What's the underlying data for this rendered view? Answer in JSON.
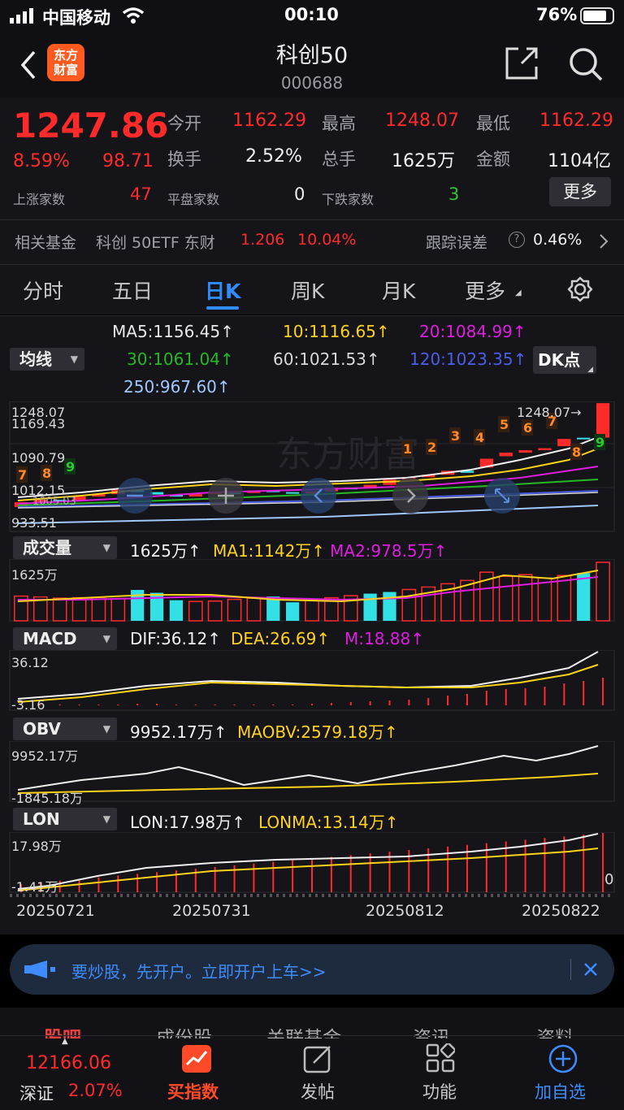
{
  "status_bar": {
    "carrier": "中国移动",
    "time": "00:10",
    "battery": "76%"
  },
  "header": {
    "title": "科创50",
    "code": "000688",
    "logo_text_1": "东方",
    "logo_text_2": "财富"
  },
  "quote": {
    "price": "1247.86",
    "change_pct": "8.59%",
    "change": "98.71",
    "open_label": "今开",
    "open": "1162.29",
    "high_label": "最高",
    "high": "1248.07",
    "low_label": "最低",
    "low": "1162.29",
    "turnover_label": "换手",
    "turnover": "2.52%",
    "volume_label": "总手",
    "volume": "1625万",
    "amount_label": "金额",
    "amount": "1104亿",
    "up_label": "上涨家数",
    "up": "47",
    "flat_label": "平盘家数",
    "flat": "0",
    "down_label": "下跌家数",
    "down": "3",
    "more": "更多"
  },
  "fund": {
    "label": "相关基金",
    "name": "科创 50ETF 东财",
    "price": "1.206",
    "pct": "10.04%",
    "track_label": "跟踪误差",
    "track": "0.46%"
  },
  "tabs": [
    "分时",
    "五日",
    "日K",
    "周K",
    "月K",
    "更多"
  ],
  "active_tab": 2,
  "ma": {
    "selector": "均线",
    "ma5": "MA5:1156.45↑",
    "ma10": "10:1116.65↑",
    "ma20": "20:1084.99↑",
    "ma30": "30:1061.04↑",
    "ma60": "60:1021.53↑",
    "ma120": "120:1023.35↑",
    "ma250": "250:967.60↑",
    "dk": "DK点"
  },
  "kline_axis": {
    "high": "1248.07",
    "y1": "1169.43",
    "y2": "1090.79",
    "y3": "1012.15",
    "low": "933.51",
    "max_marker": "1248.07→",
    "overlap": "1005.03"
  },
  "volume": {
    "selector": "成交量",
    "value": "1625万↑",
    "ma1": "MA1:1142万↑",
    "ma2": "MA2:978.5万↑",
    "axis_top": "1625万"
  },
  "macd": {
    "selector": "MACD",
    "dif": "DIF:36.12↑",
    "dea": "DEA:26.69↑",
    "m": "M:18.88↑",
    "axis_top": "36.12",
    "axis_bottom": "-3.16"
  },
  "obv": {
    "selector": "OBV",
    "value": "9952.17万↑",
    "maobv": "MAOBV:2579.18万↑",
    "axis_top": "9952.17万",
    "axis_bottom": "-1845.18万"
  },
  "lon": {
    "selector": "LON",
    "value": "LON:17.98万↑",
    "lonma": "LONMA:13.14万↑",
    "axis_top": "17.98万",
    "axis_bottom": "-1.41万",
    "zero": "0"
  },
  "dates": [
    "20250721",
    "20250731",
    "20250812",
    "20250822"
  ],
  "banner": {
    "text": "要炒股，先开户。立即开户上车>>"
  },
  "sub_tabs": [
    "股吧",
    "成份股",
    "关联基金",
    "资讯",
    "资料"
  ],
  "bottom": {
    "index_value": "12166.06",
    "index_name": "深证",
    "index_pct": "2.07%",
    "buy": "买指数",
    "post": "发帖",
    "func": "功能",
    "add": "加自选"
  },
  "colors": {
    "up": "#ff2a2a",
    "down": "#2ec82e",
    "accent": "#2f8cff",
    "bear_candle": "#33e0e6"
  },
  "chart_data": {
    "type": "candlestick",
    "candles": [
      {
        "o": 990,
        "c": 1002
      },
      {
        "o": 1002,
        "c": 1008
      },
      {
        "o": 1008,
        "c": 1005
      },
      {
        "o": 1005,
        "c": 1016
      },
      {
        "o": 1016,
        "c": 1022
      },
      {
        "o": 1022,
        "c": 1033
      },
      {
        "o": 1033,
        "c": 1027
      },
      {
        "o": 1027,
        "c": 1021
      },
      {
        "o": 1021,
        "c": 1016
      },
      {
        "o": 1016,
        "c": 1022
      },
      {
        "o": 1022,
        "c": 1026
      },
      {
        "o": 1026,
        "c": 1025
      },
      {
        "o": 1025,
        "c": 1031
      },
      {
        "o": 1031,
        "c": 1027
      },
      {
        "o": 1027,
        "c": 1023
      },
      {
        "o": 1023,
        "c": 1029
      },
      {
        "o": 1029,
        "c": 1038
      },
      {
        "o": 1038,
        "c": 1036
      },
      {
        "o": 1036,
        "c": 1045
      },
      {
        "o": 1045,
        "c": 1058
      },
      {
        "o": 1058,
        "c": 1064
      },
      {
        "o": 1064,
        "c": 1070
      },
      {
        "o": 1070,
        "c": 1080
      },
      {
        "o": 1080,
        "c": 1075
      },
      {
        "o": 1088,
        "c": 1110
      },
      {
        "o": 1116,
        "c": 1125
      },
      {
        "o": 1125,
        "c": 1131
      },
      {
        "o": 1131,
        "c": 1136
      },
      {
        "o": 1141,
        "c": 1159
      },
      {
        "o": 1162,
        "c": 1160
      },
      {
        "o": 1162.29,
        "c": 1247.86
      }
    ],
    "volume": [
      60,
      58,
      55,
      56,
      57,
      54,
      75,
      68,
      50,
      47,
      48,
      52,
      55,
      59,
      45,
      50,
      56,
      61,
      66,
      70,
      76,
      82,
      90,
      98,
      118,
      108,
      112,
      104,
      110,
      116,
      142
    ],
    "volume_down": [
      6,
      7,
      8,
      13,
      14,
      18,
      19,
      29
    ],
    "macd_hist": [
      1,
      1,
      1,
      1,
      1,
      1,
      2,
      2,
      1,
      1,
      1,
      1,
      1,
      1,
      1,
      2,
      3,
      4,
      5,
      6,
      7,
      9,
      12,
      14,
      18,
      20,
      21,
      23,
      27,
      30,
      34
    ]
  }
}
